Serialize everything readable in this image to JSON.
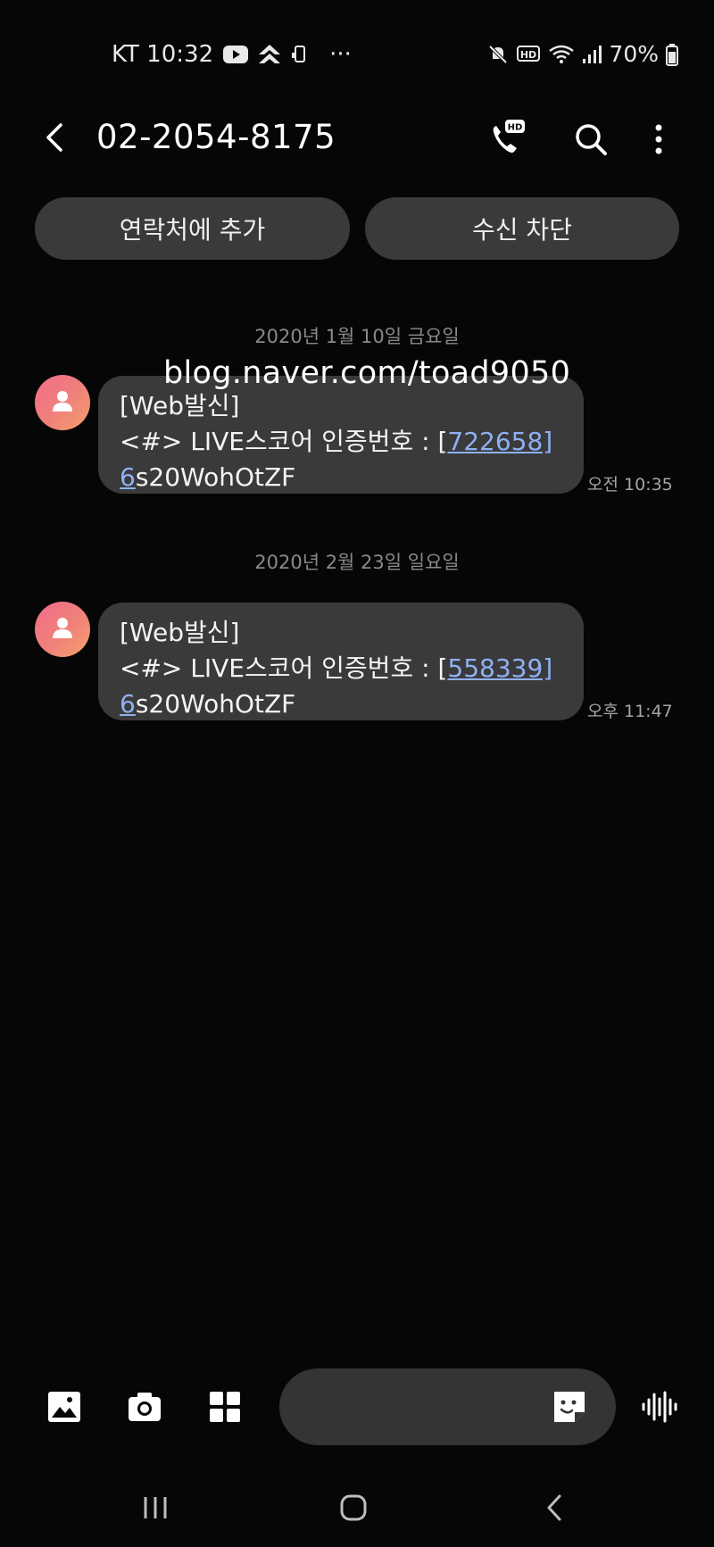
{
  "status_bar": {
    "carrier_time": "KT 10:32",
    "more": "···",
    "battery": "70%"
  },
  "header": {
    "title": "02-2054-8175"
  },
  "actions": {
    "add_contact": "연락처에 추가",
    "block": "수신 차단"
  },
  "watermark": "blog.naver.com/toad9050",
  "conversation": [
    {
      "date": "2020년 1월 10일 금요일",
      "line1": "[Web발신]",
      "line2_prefix": "<#> LIVE스코어 인증번호 : [",
      "code": "722658]",
      "code_tail": "6",
      "line3_rest": "s20WohOtZF",
      "time": "오전 10:35"
    },
    {
      "date": "2020년 2월 23일 일요일",
      "line1": "[Web발신]",
      "line2_prefix": "<#> LIVE스코어 인증번호 : [",
      "code": "558339]",
      "code_tail": "6",
      "line3_rest": "s20WohOtZF",
      "time": "오후 11:47"
    }
  ],
  "icons": {
    "status": [
      "youtube-icon",
      "navigation-icon",
      "phone-sync-icon",
      "mute-icon",
      "hd-voice-icon",
      "wifi-icon",
      "signal-icon",
      "battery-icon"
    ],
    "header": [
      "back-arrow-icon",
      "hd-call-icon",
      "search-icon",
      "more-vert-icon"
    ],
    "composer": [
      "gallery-icon",
      "camera-icon",
      "apps-grid-icon",
      "sticker-icon",
      "voice-wave-icon"
    ],
    "nav": [
      "recents-icon",
      "home-icon",
      "nav-back-icon"
    ]
  },
  "colors": {
    "background": "#060606",
    "bubble": "#3a3a3a",
    "link": "#8fb0f5",
    "avatar_start": "#f16c8a",
    "avatar_end": "#f5a06a"
  }
}
